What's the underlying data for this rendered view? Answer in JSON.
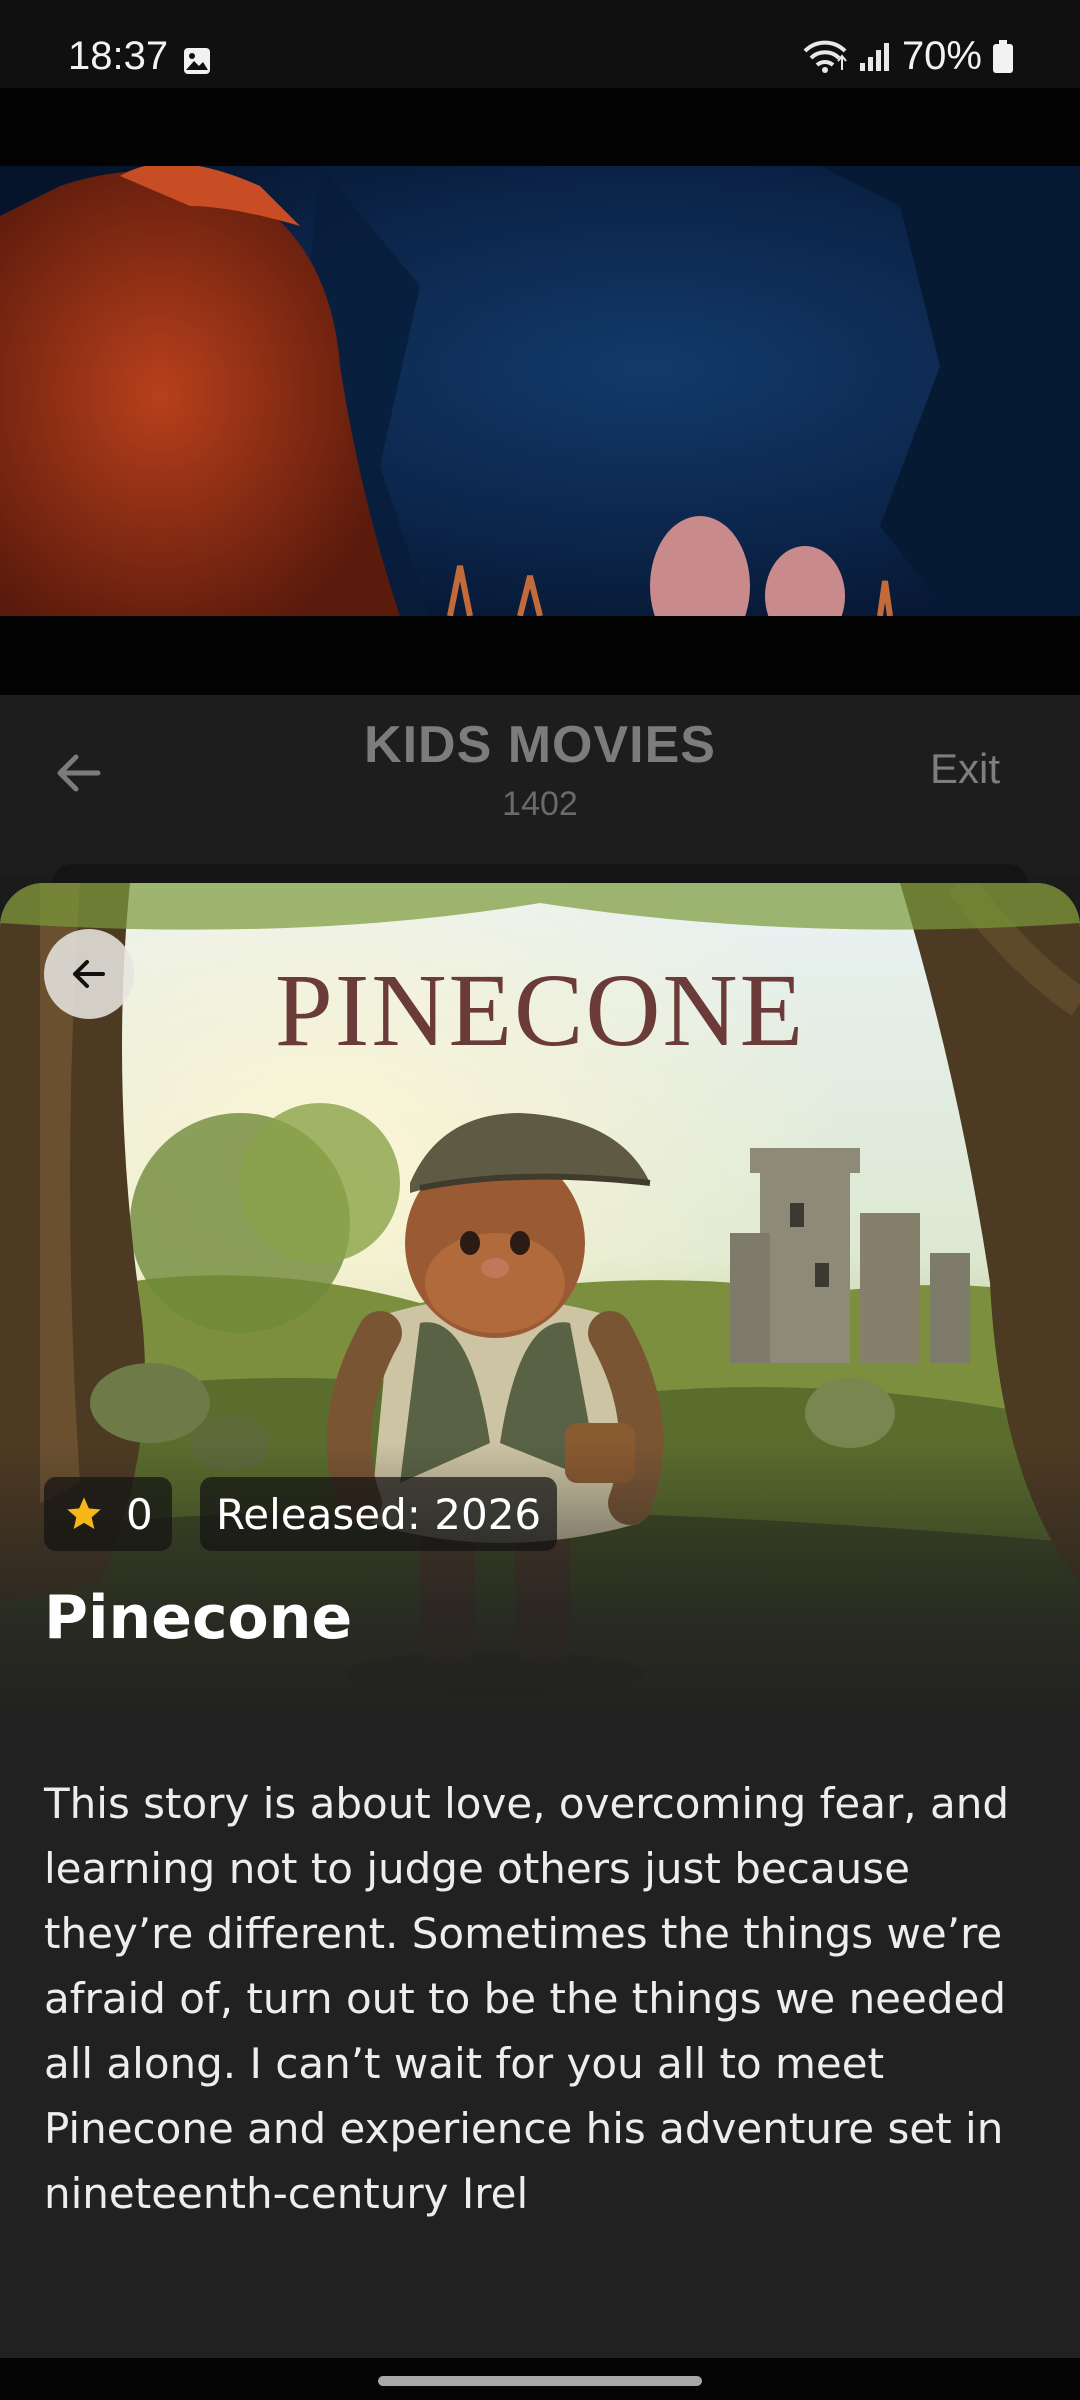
{
  "status_bar": {
    "time": "18:37",
    "battery": "70%"
  },
  "header": {
    "title": "KIDS MOVIES",
    "subtitle": "1402",
    "exit_label": "Exit"
  },
  "movie": {
    "poster_title": "PINECONE",
    "rating": "0",
    "release": "Released: 2026",
    "title": "Pinecone",
    "description": "This story is about love, overcoming fear, and learning not to judge others just because they’re different. Sometimes the things we’re afraid of, turn out to be the things we needed all along. I can’t wait for you all to meet Pinecone and experience his adventure set in nineteenth-century Irel"
  },
  "colors": {
    "background": "#1b1b1b",
    "sheet": "#212121",
    "star": "#f5b818",
    "header_text": "#7c7c7c"
  }
}
